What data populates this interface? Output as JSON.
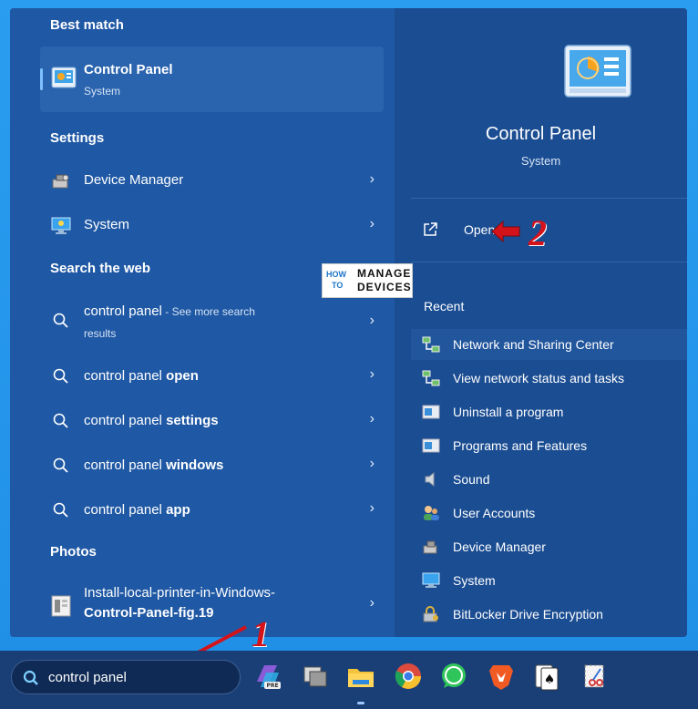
{
  "start_menu": {
    "best_match": {
      "heading": "Best match",
      "title": "Control Panel",
      "subtitle": "System"
    },
    "settings": {
      "heading": "Settings",
      "items": [
        {
          "label": "Device Manager",
          "icon": "device-manager-icon"
        },
        {
          "label": "System",
          "icon": "monitor-icon"
        }
      ]
    },
    "web": {
      "heading": "Search the web",
      "items": [
        {
          "prefix": "control panel",
          "bold": "",
          "suffix": " - See more search",
          "suffix2": "results"
        },
        {
          "prefix": "control panel ",
          "bold": "open"
        },
        {
          "prefix": "control panel ",
          "bold": "settings"
        },
        {
          "prefix": "control panel ",
          "bold": "windows"
        },
        {
          "prefix": "control panel ",
          "bold": "app"
        }
      ]
    },
    "photos": {
      "heading": "Photos",
      "item_line1": "Install-local-printer-in-Windows-",
      "item_line2": "Control-Panel-fig.19"
    },
    "detail": {
      "title": "Control Panel",
      "subtitle": "System",
      "open_label": "Open",
      "recent_heading": "Recent",
      "recent": [
        "Network and Sharing Center",
        "View network status and tasks",
        "Uninstall a program",
        "Programs and Features",
        "Sound",
        "User Accounts",
        "Device Manager",
        "System",
        "BitLocker Drive Encryption"
      ]
    }
  },
  "annotations": {
    "step1": "1",
    "step2": "2"
  },
  "logo": {
    "how": "HOW",
    "to": "TO",
    "manage": "MANAGE",
    "devices": "DEVICES"
  },
  "taskbar": {
    "search_value": "control panel"
  },
  "colors": {
    "accent": "#7fc1ff",
    "panel": "#1f58a4",
    "annotation": "#d4121a"
  }
}
